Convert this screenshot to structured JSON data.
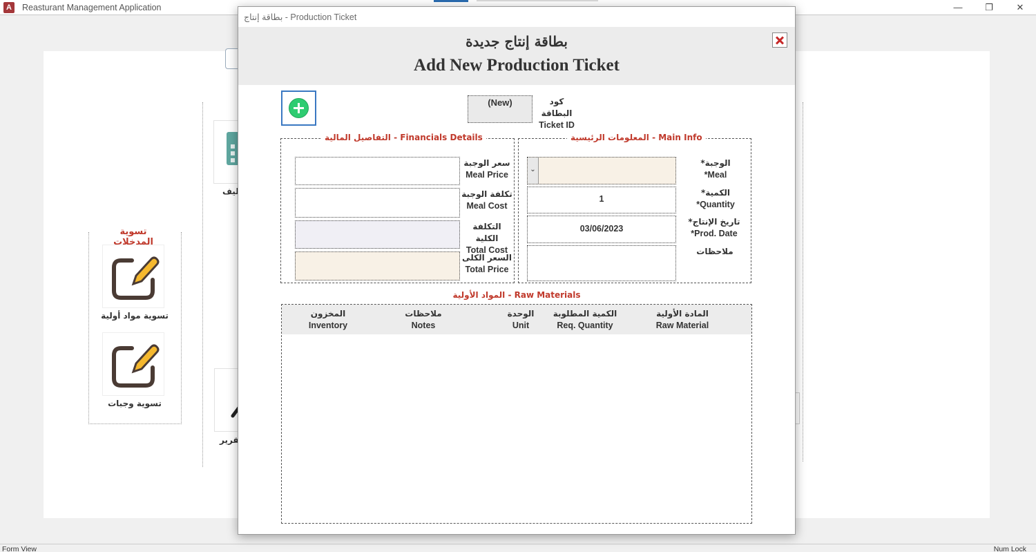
{
  "app": {
    "logo_letter": "A",
    "title": "Reasturant Management Application",
    "minimize": "—",
    "restore": "❐",
    "close": "✕"
  },
  "background": {
    "section_title": "تسوية المدخلات",
    "tiles": [
      {
        "label": "تسوية مواد أولية",
        "icon": "edit-icon"
      },
      {
        "label": "تسوية وجبات",
        "icon": "edit-icon"
      }
    ],
    "partial_labels": {
      "top": "اليف",
      "bottom": "تقرير"
    }
  },
  "dialog": {
    "window_title": "بطاقة إنتاج - Production Ticket",
    "header_ar": "بطاقة إنتاج جديدة",
    "header_en": "Add New Production Ticket",
    "ticket_id": {
      "value": "(New)",
      "label_ar": "كود البطاقة",
      "label_en": "Ticket ID"
    },
    "main_info": {
      "title": "المعلومات الرئيسية - Main Info",
      "meal": {
        "label_ar": "الوجبة*",
        "label_en": "*Meal",
        "value": ""
      },
      "quantity": {
        "label_ar": "الكمية*",
        "label_en": "*Quantity",
        "value": "1"
      },
      "prod_date": {
        "label_ar": "تاريخ الإنتاج*",
        "label_en": "*Prod. Date",
        "value": "03/06/2023"
      },
      "notes": {
        "label_ar": "ملاحظات",
        "value": ""
      }
    },
    "financials": {
      "title": "التفاصيل المالية - Financials Details",
      "meal_price": {
        "label_ar": "سعر الوجبة",
        "label_en": "Meal Price",
        "value": ""
      },
      "meal_cost": {
        "label_ar": "تكلفة الوجبة",
        "label_en": "Meal Cost",
        "value": ""
      },
      "total_cost": {
        "label_ar": "التكلفة الكلية",
        "label_en": "Total Cost",
        "value": ""
      },
      "total_price": {
        "label_ar": "السعر الكلى",
        "label_en": "Total Price",
        "value": ""
      }
    },
    "raw_materials": {
      "title": "المواد الأولية - Raw Materials",
      "columns": [
        {
          "ar": "المخزون",
          "en": "Inventory"
        },
        {
          "ar": "ملاحظات",
          "en": "Notes"
        },
        {
          "ar": "الوحدة",
          "en": "Unit"
        },
        {
          "ar": "الكمية المطلوبة",
          "en": "Req. Quantity"
        },
        {
          "ar": "المادة الأولية",
          "en": "Raw Material"
        }
      ]
    }
  },
  "statusbar": {
    "left": "Form View",
    "right": "Num Lock"
  }
}
